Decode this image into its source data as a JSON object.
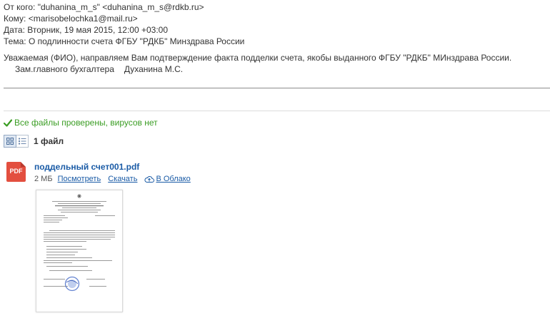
{
  "header": {
    "from_label": "От кого:",
    "from_value": "\"duhanina_m_s\" <duhanina_m_s@rdkb.ru>",
    "to_label": "Кому:",
    "to_value": "<marisobelochka1@mail.ru>",
    "date_label": "Дата:",
    "date_value": "Вторник, 19 мая 2015, 12:00 +03:00",
    "subject_label": "Тема:",
    "subject_value": "О подлинности счета ФГБУ \"РДКБ\" Минздрава России"
  },
  "body": {
    "paragraph": "Уважаемая (ФИО), направляем Вам подтверждение факта подделки счета, якобы выданного ФГБУ \"РДКБ\" МИнздрава России.",
    "signature_title": "Зам.главного бухгалтера",
    "signature_name": "Духанина М.С."
  },
  "attachments": {
    "scan_status": "Все файлы проверены, вирусов нет",
    "count_label": "1 файл",
    "view_icons": [
      "grid-view-icon",
      "list-view-icon"
    ],
    "files": [
      {
        "icon_label": "PDF",
        "name": "поддельный счет001.pdf",
        "size": "2 МБ",
        "view_link": "Посмотреть",
        "download_link": "Скачать",
        "cloud_link": "В Облако"
      }
    ]
  },
  "colors": {
    "link": "#1a5ba6",
    "ok_green": "#3a9d23",
    "pdf_red": "#e34f3f",
    "stamp_blue": "#4a6fc9"
  }
}
